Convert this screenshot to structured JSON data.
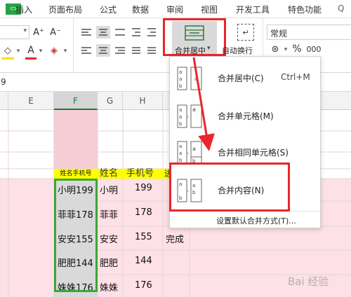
{
  "tabs": [
    "插入",
    "页面布局",
    "公式",
    "数据",
    "审阅",
    "视图",
    "开发工具",
    "特色功能"
  ],
  "ribbon": {
    "merge_label": "合并居中",
    "merge_arrow": "▾",
    "wrap_label": "自动换行",
    "number_format": "常规",
    "percent": "%",
    "thousands": "000",
    "font_grow": "A⁺",
    "font_shrink": "A⁻",
    "font_color_letter": "A"
  },
  "formula_bar": {
    "value": "9"
  },
  "columns": [
    "E",
    "F",
    "G",
    "H"
  ],
  "header_row": {
    "f": "姓名手机号",
    "g": "姓名",
    "h": "手机号",
    "i": "进"
  },
  "rows": [
    {
      "f": "小明199",
      "g": "小明",
      "h": "199",
      "i": ""
    },
    {
      "f": "菲菲178",
      "g": "菲菲",
      "h": "178",
      "i": ""
    },
    {
      "f": "安安155",
      "g": "安安",
      "h": "155",
      "i": "完成"
    },
    {
      "f": "肥肥144",
      "g": "肥肥",
      "h": "144",
      "i": ""
    },
    {
      "f": "姝姝176",
      "g": "姝姝",
      "h": "176",
      "i": ""
    }
  ],
  "menu": {
    "items": [
      {
        "label": "合并居中(C)",
        "shortcut": "Ctrl+M"
      },
      {
        "label": "合并单元格(M)",
        "shortcut": ""
      },
      {
        "label": "合并相同单元格(S)",
        "shortcut": ""
      },
      {
        "label": "合并内容(N)",
        "shortcut": ""
      }
    ],
    "footer": "设置默认合并方式(T)..."
  },
  "watermark": "Bai 经验",
  "colors": {
    "pink": "#fde1e6",
    "yellow": "#ffff00",
    "highlight_red": "#e8262b",
    "green_border": "#3aa63a",
    "selected_col": "#f4c9d1"
  }
}
